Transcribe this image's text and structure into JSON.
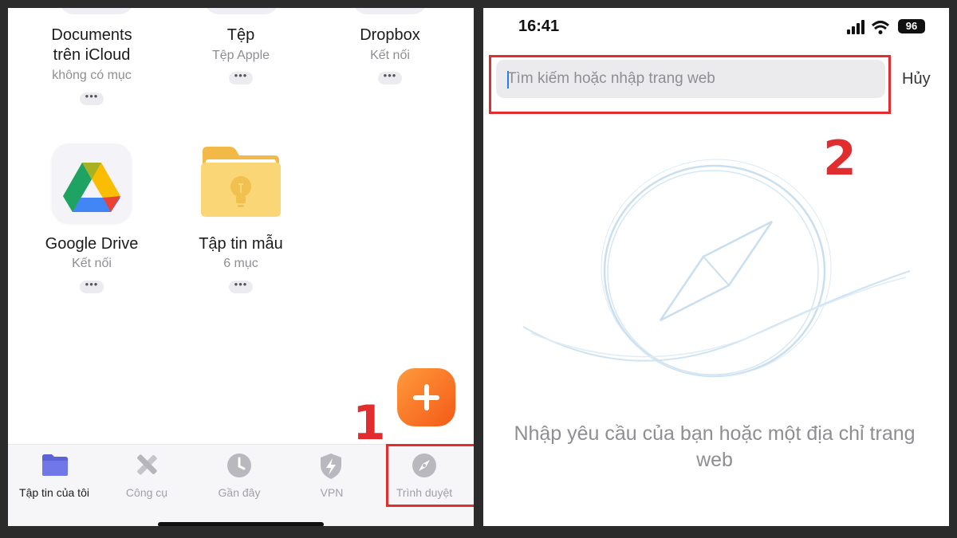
{
  "left": {
    "items_top": [
      {
        "name": "Documents\ntrên iCloud",
        "sub": "không có mục"
      },
      {
        "name": "Tệp",
        "sub": "Tệp Apple"
      },
      {
        "name": "Dropbox",
        "sub": "Kết nối"
      }
    ],
    "items_bottom": [
      {
        "name": "Google Drive",
        "sub": "Kết nối",
        "icon": "google-drive-icon"
      },
      {
        "name": "Tập tin mẫu",
        "sub": "6 mục",
        "icon": "folder-lightbulb-icon"
      }
    ],
    "more_label": "•••",
    "step_label": "1",
    "tabs": [
      {
        "label": "Tập tin của tôi",
        "icon": "folder-icon",
        "active": true
      },
      {
        "label": "Công cụ",
        "icon": "tools-icon",
        "active": false
      },
      {
        "label": "Gần đây",
        "icon": "clock-icon",
        "active": false
      },
      {
        "label": "VPN",
        "icon": "shield-bolt-icon",
        "active": false
      },
      {
        "label": "Trình duyệt",
        "icon": "compass-icon",
        "active": false
      }
    ]
  },
  "right": {
    "status_time": "16:41",
    "battery": "96",
    "search_placeholder": "Tìm kiếm hoặc nhập trang web",
    "cancel_label": "Hủy",
    "step_label": "2",
    "empty_message": "Nhập yêu cầu của bạn hoặc một địa chỉ trang web"
  },
  "colors": {
    "annotation_red": "#e12d2d",
    "fab_orange": "#f47a24",
    "folder_blue": "#5a63d8",
    "caret_blue": "#2a7cf6"
  }
}
